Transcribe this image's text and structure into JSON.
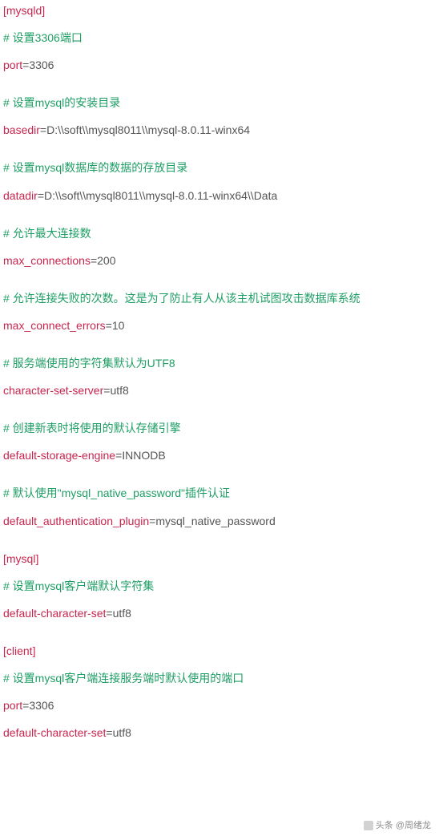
{
  "config": {
    "mysqld": {
      "section_label": "[mysqld]",
      "port": {
        "comment": "# 设置3306端口",
        "key": "port",
        "value": "3306"
      },
      "basedir": {
        "comment": "# 设置mysql的安装目录",
        "key": "basedir",
        "value": "D:\\\\soft\\\\mysql8011\\\\mysql-8.0.11-winx64"
      },
      "datadir": {
        "comment": "# 设置mysql数据库的数据的存放目录",
        "key": "datadir",
        "value": "D:\\\\soft\\\\mysql8011\\\\mysql-8.0.11-winx64\\\\Data"
      },
      "max_connections": {
        "comment": "# 允许最大连接数",
        "key": "max_connections",
        "value": "200"
      },
      "max_connect_errors": {
        "comment": "# 允许连接失败的次数。这是为了防止有人从该主机试图攻击数据库系统",
        "key": "max_connect_errors",
        "value": "10"
      },
      "character_set_server": {
        "comment": "# 服务端使用的字符集默认为UTF8",
        "key": "character-set-server",
        "value": "utf8"
      },
      "default_storage_engine": {
        "comment": "# 创建新表时将使用的默认存储引擎",
        "key": "default-storage-engine",
        "value": "INNODB"
      },
      "default_authentication_plugin": {
        "comment": "# 默认使用\"mysql_native_password\"插件认证",
        "key": "default_authentication_plugin",
        "value": "mysql_native_password"
      }
    },
    "mysql": {
      "section_label": "[mysql]",
      "default_character_set": {
        "comment": "# 设置mysql客户端默认字符集",
        "key": "default-character-set",
        "value": "utf8"
      }
    },
    "client": {
      "section_label": "[client]",
      "comment": "# 设置mysql客户端连接服务端时默认使用的端口",
      "port": {
        "key": "port",
        "value": "3306"
      },
      "default_character_set": {
        "key": "default-character-set",
        "value": "utf8"
      }
    }
  },
  "equals": "=",
  "watermark": "头条 @周绪龙"
}
